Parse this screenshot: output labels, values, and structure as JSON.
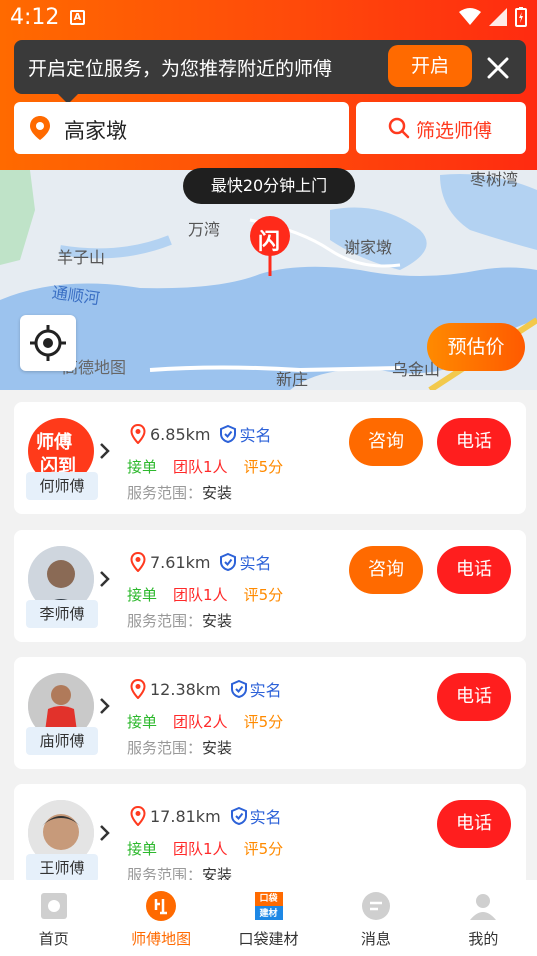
{
  "status_bar": {
    "time": "4:12"
  },
  "location_banner": {
    "text": "开启定位服务，为您推荐附近的师傅",
    "open_label": "开启"
  },
  "search": {
    "location": "高家墩",
    "filter_label": "筛选师傅"
  },
  "map": {
    "tooltip": "最快20分钟上门",
    "pin_label": "闪",
    "labels": [
      "万湾",
      "羊子山",
      "谢家墩",
      "通顺河",
      "新庄",
      "乌金山",
      "高德地图",
      "枣树湾"
    ],
    "estimate_label": "预估价"
  },
  "workers": [
    {
      "name": "何师傅",
      "distance": "6.85km",
      "verified": "实名",
      "tags": [
        "接单",
        "团队1人",
        "评5分"
      ],
      "scope_label": "服务范围：",
      "scope": "安装",
      "consult_label": "咨询",
      "call_label": "电话",
      "avatar_text": [
        "师傅",
        "闪到"
      ]
    },
    {
      "name": "李师傅",
      "distance": "7.61km",
      "verified": "实名",
      "tags": [
        "接单",
        "团队1人",
        "评5分"
      ],
      "scope_label": "服务范围：",
      "scope": "安装",
      "consult_label": "咨询",
      "call_label": "电话"
    },
    {
      "name": "庙师傅",
      "distance": "12.38km",
      "verified": "实名",
      "tags": [
        "接单",
        "团队2人",
        "评5分"
      ],
      "scope_label": "服务范围：",
      "scope": "安装",
      "call_label": "电话"
    },
    {
      "name": "王师傅",
      "distance": "17.81km",
      "verified": "实名",
      "tags": [
        "接单",
        "团队1人",
        "评5分"
      ],
      "scope_label": "服务范围：",
      "scope": "安装",
      "call_label": "电话"
    }
  ],
  "bottom_nav": [
    {
      "label": "首页",
      "icon": "home-icon"
    },
    {
      "label": "师傅地图",
      "icon": "worker-map-icon"
    },
    {
      "label": "口袋建材",
      "icon": "pocket-materials-icon",
      "icon_text": [
        "口袋",
        "建材"
      ]
    },
    {
      "label": "消息",
      "icon": "message-icon"
    },
    {
      "label": "我的",
      "icon": "profile-icon"
    }
  ],
  "colors": {
    "primary": "#ff6a00",
    "call": "#ff1e1e",
    "verified": "#2d62d8"
  }
}
